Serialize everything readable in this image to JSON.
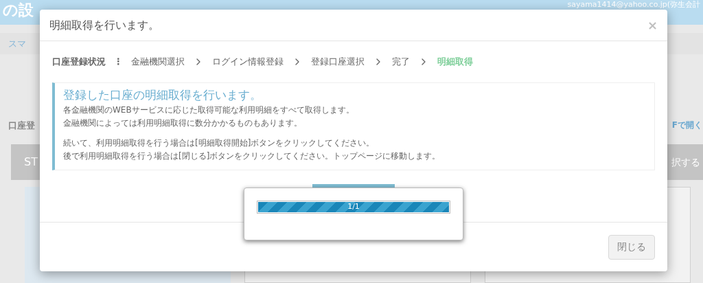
{
  "background": {
    "header_title": "の設",
    "user": "sayama1414@yahoo.co.jp(弥生会計",
    "breadcrumb": "スマ",
    "section_label": "口座登",
    "pdf_link": "Fで開く",
    "banner_left": "ST",
    "banner_right": "択する"
  },
  "dialog": {
    "title": "明細取得を行います。",
    "close": "×",
    "steps_label": "口座登録状況",
    "steps_separator": "⋮",
    "steps": [
      {
        "label": "金融機関選択",
        "selected": false
      },
      {
        "label": "ログイン情報登録",
        "selected": false
      },
      {
        "label": "登録口座選択",
        "selected": false
      },
      {
        "label": "完了",
        "selected": false
      },
      {
        "label": "明細取得",
        "selected": true
      }
    ],
    "heading": "登録した口座の明細取得を行います。",
    "paragraphs": [
      [
        "各金融機関のWEBサービスに応じた取得可能な利用明細をすべて取得します。",
        "金融機関によっては利用明細取得に数分かかるものもあります。"
      ],
      [
        "続いて、利用明細取得を行う場合は[明細取得開始]ボタンをクリックしてください。",
        "後で利用明細取得を行う場合は[閉じる]ボタンをクリックしてください。トップページに移動します。"
      ]
    ],
    "close_button": "閉じる"
  },
  "progress": {
    "level": 1,
    "reading": "1/1"
  }
}
